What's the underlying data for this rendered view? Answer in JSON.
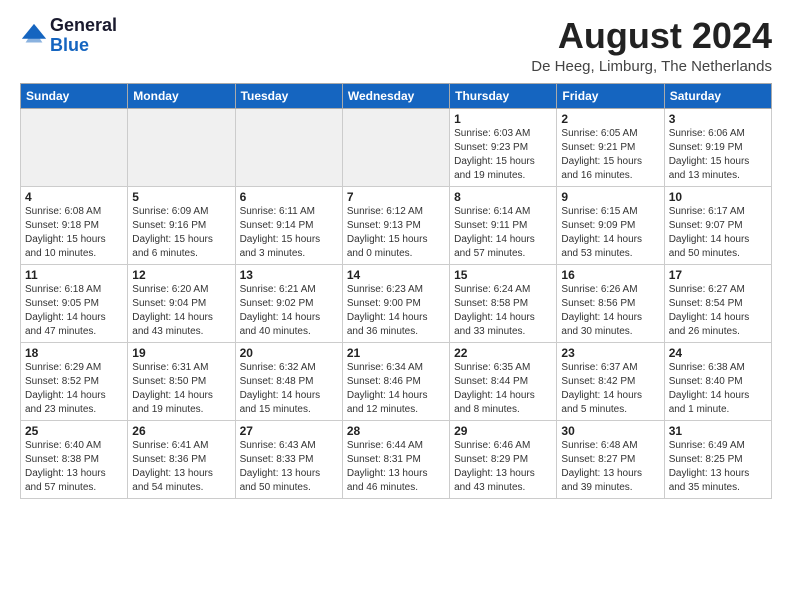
{
  "header": {
    "logo_general": "General",
    "logo_blue": "Blue",
    "month_title": "August 2024",
    "location": "De Heeg, Limburg, The Netherlands"
  },
  "weekdays": [
    "Sunday",
    "Monday",
    "Tuesday",
    "Wednesday",
    "Thursday",
    "Friday",
    "Saturday"
  ],
  "weeks": [
    [
      {
        "day": "",
        "info": ""
      },
      {
        "day": "",
        "info": ""
      },
      {
        "day": "",
        "info": ""
      },
      {
        "day": "",
        "info": ""
      },
      {
        "day": "1",
        "info": "Sunrise: 6:03 AM\nSunset: 9:23 PM\nDaylight: 15 hours\nand 19 minutes."
      },
      {
        "day": "2",
        "info": "Sunrise: 6:05 AM\nSunset: 9:21 PM\nDaylight: 15 hours\nand 16 minutes."
      },
      {
        "day": "3",
        "info": "Sunrise: 6:06 AM\nSunset: 9:19 PM\nDaylight: 15 hours\nand 13 minutes."
      }
    ],
    [
      {
        "day": "4",
        "info": "Sunrise: 6:08 AM\nSunset: 9:18 PM\nDaylight: 15 hours\nand 10 minutes."
      },
      {
        "day": "5",
        "info": "Sunrise: 6:09 AM\nSunset: 9:16 PM\nDaylight: 15 hours\nand 6 minutes."
      },
      {
        "day": "6",
        "info": "Sunrise: 6:11 AM\nSunset: 9:14 PM\nDaylight: 15 hours\nand 3 minutes."
      },
      {
        "day": "7",
        "info": "Sunrise: 6:12 AM\nSunset: 9:13 PM\nDaylight: 15 hours\nand 0 minutes."
      },
      {
        "day": "8",
        "info": "Sunrise: 6:14 AM\nSunset: 9:11 PM\nDaylight: 14 hours\nand 57 minutes."
      },
      {
        "day": "9",
        "info": "Sunrise: 6:15 AM\nSunset: 9:09 PM\nDaylight: 14 hours\nand 53 minutes."
      },
      {
        "day": "10",
        "info": "Sunrise: 6:17 AM\nSunset: 9:07 PM\nDaylight: 14 hours\nand 50 minutes."
      }
    ],
    [
      {
        "day": "11",
        "info": "Sunrise: 6:18 AM\nSunset: 9:05 PM\nDaylight: 14 hours\nand 47 minutes."
      },
      {
        "day": "12",
        "info": "Sunrise: 6:20 AM\nSunset: 9:04 PM\nDaylight: 14 hours\nand 43 minutes."
      },
      {
        "day": "13",
        "info": "Sunrise: 6:21 AM\nSunset: 9:02 PM\nDaylight: 14 hours\nand 40 minutes."
      },
      {
        "day": "14",
        "info": "Sunrise: 6:23 AM\nSunset: 9:00 PM\nDaylight: 14 hours\nand 36 minutes."
      },
      {
        "day": "15",
        "info": "Sunrise: 6:24 AM\nSunset: 8:58 PM\nDaylight: 14 hours\nand 33 minutes."
      },
      {
        "day": "16",
        "info": "Sunrise: 6:26 AM\nSunset: 8:56 PM\nDaylight: 14 hours\nand 30 minutes."
      },
      {
        "day": "17",
        "info": "Sunrise: 6:27 AM\nSunset: 8:54 PM\nDaylight: 14 hours\nand 26 minutes."
      }
    ],
    [
      {
        "day": "18",
        "info": "Sunrise: 6:29 AM\nSunset: 8:52 PM\nDaylight: 14 hours\nand 23 minutes."
      },
      {
        "day": "19",
        "info": "Sunrise: 6:31 AM\nSunset: 8:50 PM\nDaylight: 14 hours\nand 19 minutes."
      },
      {
        "day": "20",
        "info": "Sunrise: 6:32 AM\nSunset: 8:48 PM\nDaylight: 14 hours\nand 15 minutes."
      },
      {
        "day": "21",
        "info": "Sunrise: 6:34 AM\nSunset: 8:46 PM\nDaylight: 14 hours\nand 12 minutes."
      },
      {
        "day": "22",
        "info": "Sunrise: 6:35 AM\nSunset: 8:44 PM\nDaylight: 14 hours\nand 8 minutes."
      },
      {
        "day": "23",
        "info": "Sunrise: 6:37 AM\nSunset: 8:42 PM\nDaylight: 14 hours\nand 5 minutes."
      },
      {
        "day": "24",
        "info": "Sunrise: 6:38 AM\nSunset: 8:40 PM\nDaylight: 14 hours\nand 1 minute."
      }
    ],
    [
      {
        "day": "25",
        "info": "Sunrise: 6:40 AM\nSunset: 8:38 PM\nDaylight: 13 hours\nand 57 minutes."
      },
      {
        "day": "26",
        "info": "Sunrise: 6:41 AM\nSunset: 8:36 PM\nDaylight: 13 hours\nand 54 minutes."
      },
      {
        "day": "27",
        "info": "Sunrise: 6:43 AM\nSunset: 8:33 PM\nDaylight: 13 hours\nand 50 minutes."
      },
      {
        "day": "28",
        "info": "Sunrise: 6:44 AM\nSunset: 8:31 PM\nDaylight: 13 hours\nand 46 minutes."
      },
      {
        "day": "29",
        "info": "Sunrise: 6:46 AM\nSunset: 8:29 PM\nDaylight: 13 hours\nand 43 minutes."
      },
      {
        "day": "30",
        "info": "Sunrise: 6:48 AM\nSunset: 8:27 PM\nDaylight: 13 hours\nand 39 minutes."
      },
      {
        "day": "31",
        "info": "Sunrise: 6:49 AM\nSunset: 8:25 PM\nDaylight: 13 hours\nand 35 minutes."
      }
    ]
  ]
}
